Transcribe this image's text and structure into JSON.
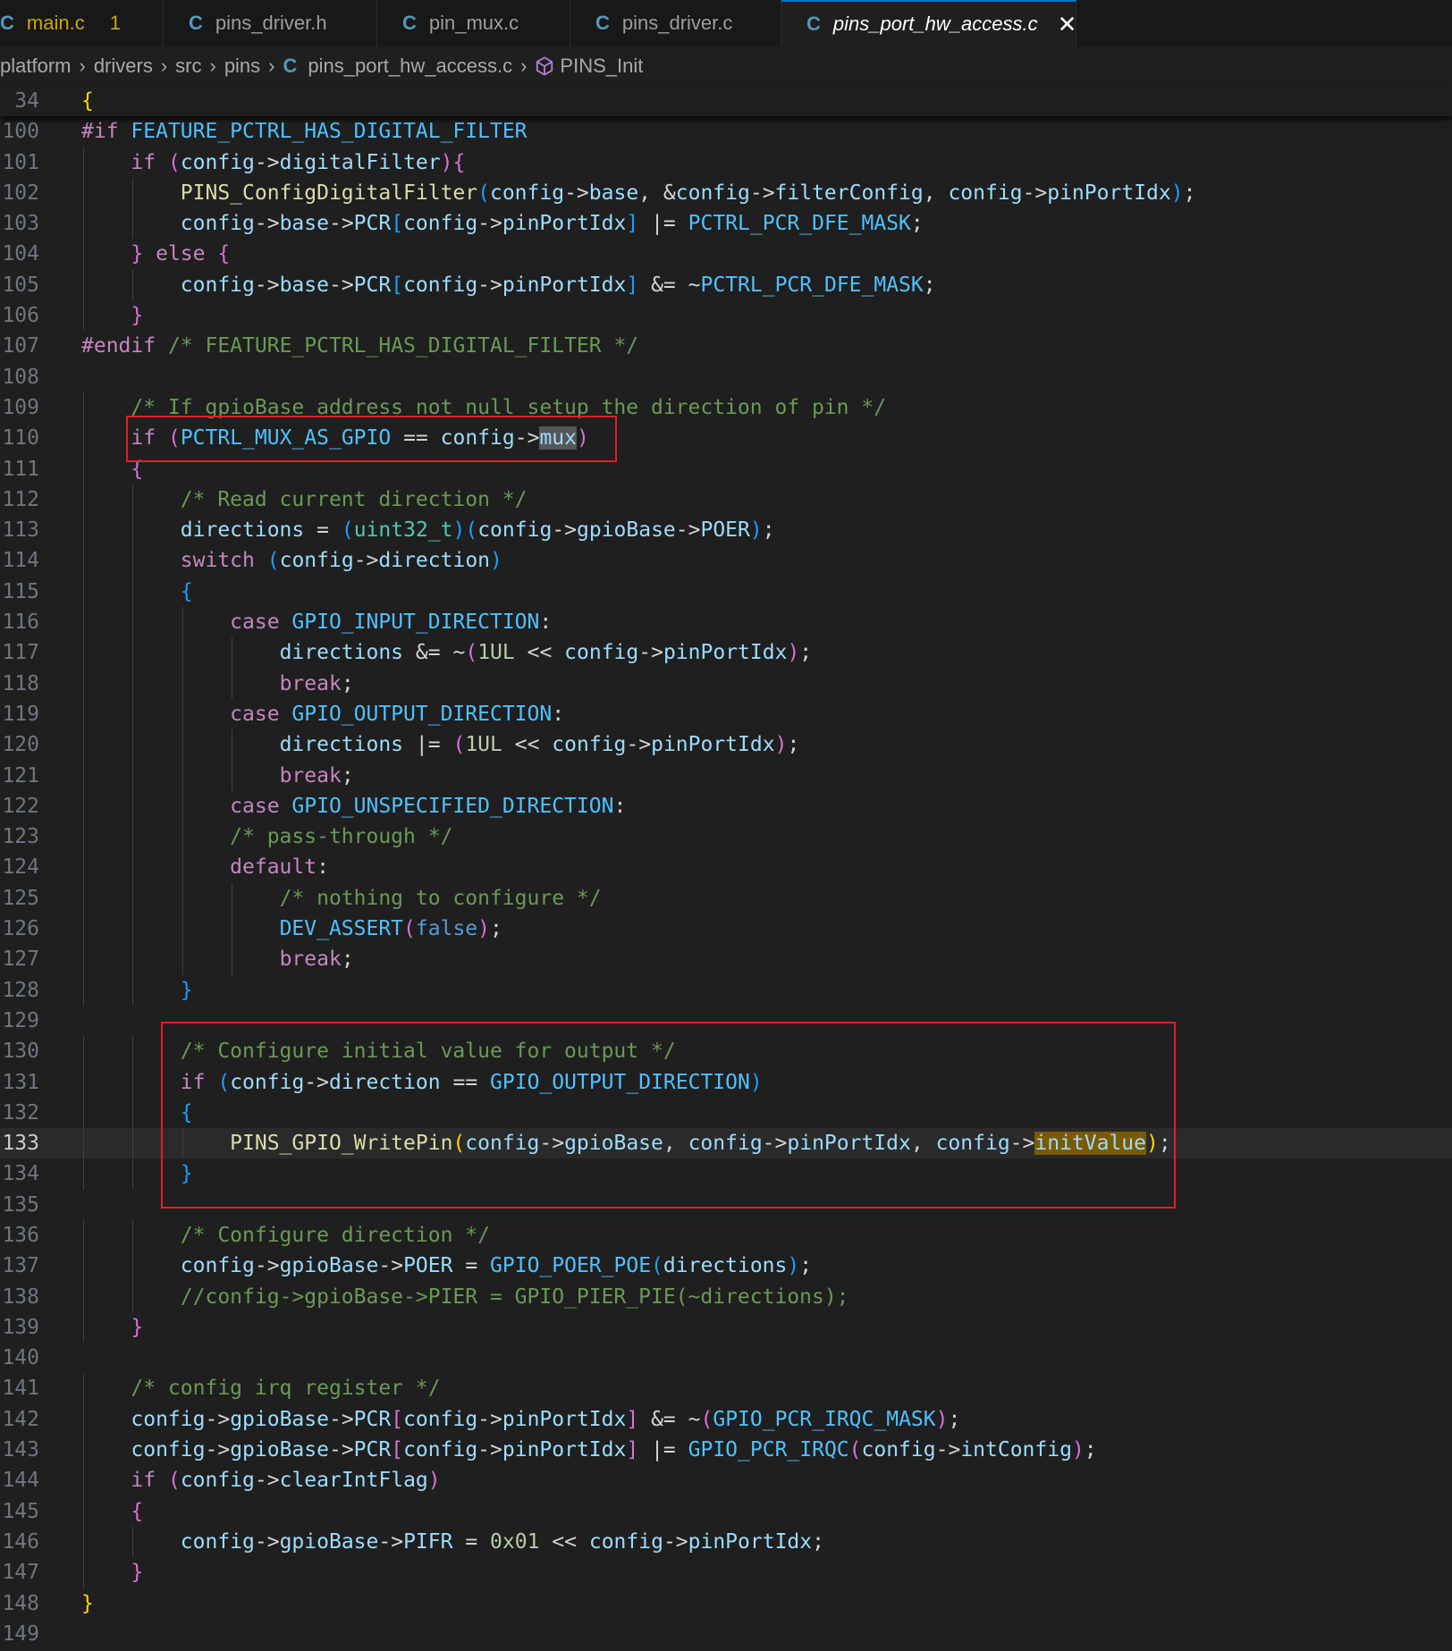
{
  "tabs": [
    {
      "label": "main.c",
      "badge": "1",
      "active": false
    },
    {
      "label": "pins_driver.h",
      "active": false
    },
    {
      "label": "pin_mux.c",
      "active": false
    },
    {
      "label": "pins_driver.c",
      "active": false
    },
    {
      "label": "pins_port_hw_access.c",
      "active": true
    }
  ],
  "file_icon_label": "C",
  "breadcrumb": {
    "items": [
      "platform",
      "drivers",
      "src",
      "pins",
      "pins_port_hw_access.c",
      "PINS_Init"
    ]
  },
  "code": {
    "sticky_line": {
      "num": "34",
      "text": "{"
    },
    "current_line": "133",
    "lines": [
      {
        "num": "100",
        "text": "#if FEATURE_PCTRL_HAS_DIGITAL_FILTER"
      },
      {
        "num": "101",
        "text": "    if (config->digitalFilter){"
      },
      {
        "num": "102",
        "text": "        PINS_ConfigDigitalFilter(config->base, &config->filterConfig, config->pinPortIdx);"
      },
      {
        "num": "103",
        "text": "        config->base->PCR[config->pinPortIdx] |= PCTRL_PCR_DFE_MASK;"
      },
      {
        "num": "104",
        "text": "    } else {"
      },
      {
        "num": "105",
        "text": "        config->base->PCR[config->pinPortIdx] &= ~PCTRL_PCR_DFE_MASK;"
      },
      {
        "num": "106",
        "text": "    }"
      },
      {
        "num": "107",
        "text": "#endif /* FEATURE_PCTRL_HAS_DIGITAL_FILTER */"
      },
      {
        "num": "108",
        "text": ""
      },
      {
        "num": "109",
        "text": "    /* If gpioBase address not null setup the direction of pin */"
      },
      {
        "num": "110",
        "text": "    if (PCTRL_MUX_AS_GPIO == config->mux)"
      },
      {
        "num": "111",
        "text": "    {"
      },
      {
        "num": "112",
        "text": "        /* Read current direction */"
      },
      {
        "num": "113",
        "text": "        directions = (uint32_t)(config->gpioBase->POER);"
      },
      {
        "num": "114",
        "text": "        switch (config->direction)"
      },
      {
        "num": "115",
        "text": "        {"
      },
      {
        "num": "116",
        "text": "            case GPIO_INPUT_DIRECTION:"
      },
      {
        "num": "117",
        "text": "                directions &= ~(1UL << config->pinPortIdx);"
      },
      {
        "num": "118",
        "text": "                break;"
      },
      {
        "num": "119",
        "text": "            case GPIO_OUTPUT_DIRECTION:"
      },
      {
        "num": "120",
        "text": "                directions |= (1UL << config->pinPortIdx);"
      },
      {
        "num": "121",
        "text": "                break;"
      },
      {
        "num": "122",
        "text": "            case GPIO_UNSPECIFIED_DIRECTION:"
      },
      {
        "num": "123",
        "text": "            /* pass-through */"
      },
      {
        "num": "124",
        "text": "            default:"
      },
      {
        "num": "125",
        "text": "                /* nothing to configure */"
      },
      {
        "num": "126",
        "text": "                DEV_ASSERT(false);"
      },
      {
        "num": "127",
        "text": "                break;"
      },
      {
        "num": "128",
        "text": "        }"
      },
      {
        "num": "129",
        "text": ""
      },
      {
        "num": "130",
        "text": "        /* Configure initial value for output */"
      },
      {
        "num": "131",
        "text": "        if (config->direction == GPIO_OUTPUT_DIRECTION)"
      },
      {
        "num": "132",
        "text": "        {"
      },
      {
        "num": "133",
        "text": "            PINS_GPIO_WritePin(config->gpioBase, config->pinPortIdx, config->initValue);"
      },
      {
        "num": "134",
        "text": "        }"
      },
      {
        "num": "135",
        "text": ""
      },
      {
        "num": "136",
        "text": "        /* Configure direction */"
      },
      {
        "num": "137",
        "text": "        config->gpioBase->POER = GPIO_POER_POE(directions);"
      },
      {
        "num": "138",
        "text": "        //config->gpioBase->PIER = GPIO_PIER_PIE(~directions);"
      },
      {
        "num": "139",
        "text": "    }"
      },
      {
        "num": "140",
        "text": ""
      },
      {
        "num": "141",
        "text": "    /* config irq register */"
      },
      {
        "num": "142",
        "text": "    config->gpioBase->PCR[config->pinPortIdx] &= ~(GPIO_PCR_IRQC_MASK);"
      },
      {
        "num": "143",
        "text": "    config->gpioBase->PCR[config->pinPortIdx] |= GPIO_PCR_IRQC(config->intConfig);"
      },
      {
        "num": "144",
        "text": "    if (config->clearIntFlag)"
      },
      {
        "num": "145",
        "text": "    {"
      },
      {
        "num": "146",
        "text": "        config->gpioBase->PIFR = 0x01 << config->pinPortIdx;"
      },
      {
        "num": "147",
        "text": "    }"
      },
      {
        "num": "148",
        "text": "}"
      },
      {
        "num": "149",
        "text": ""
      }
    ]
  },
  "colors": {
    "background": "#1f1f1f",
    "keyword": "#c586c0",
    "function": "#dcdcaa",
    "variable": "#9cdcfe",
    "macro": "#4fc1ff",
    "comment": "#6a9955",
    "annotation_box": "#e51d25"
  }
}
